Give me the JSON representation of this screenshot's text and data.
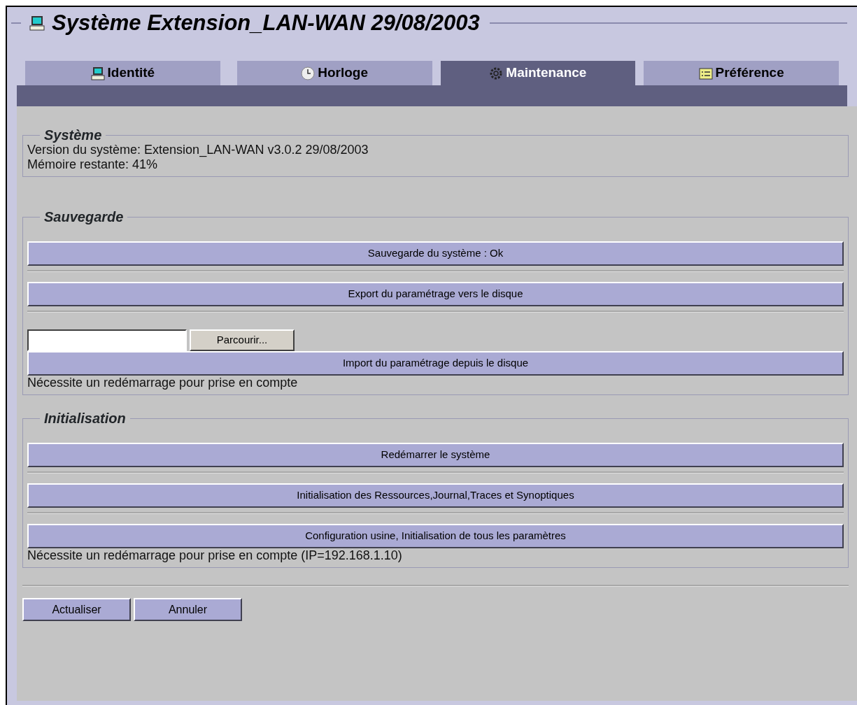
{
  "window": {
    "title": "Système Extension_LAN-WAN 29/08/2003"
  },
  "tabs": [
    {
      "label": "Identité",
      "selected": false
    },
    {
      "label": "Horloge",
      "selected": false
    },
    {
      "label": "Maintenance",
      "selected": true
    },
    {
      "label": "Préférence",
      "selected": false
    }
  ],
  "sections": [
    {
      "title": "Système",
      "items": [
        {
          "kind": "text",
          "text": "Version du système: Extension_LAN-WAN v3.0.2 29/08/2003"
        },
        {
          "kind": "text",
          "text": "Mémoire restante: 41%"
        }
      ]
    },
    {
      "title": "Sauvegarde",
      "items": [
        {
          "kind": "button",
          "label": "Sauvegarde du système : Ok"
        },
        {
          "kind": "button",
          "label": "Export du paramétrage vers le disque"
        },
        {
          "kind": "file",
          "button": "Parcourir..."
        },
        {
          "kind": "button",
          "label": "Import du paramétrage depuis le disque"
        },
        {
          "kind": "text",
          "text": "Nécessite un redémarrage pour prise en compte"
        }
      ]
    },
    {
      "title": "Initialisation",
      "items": [
        {
          "kind": "button",
          "label": "Redémarrer le système"
        },
        {
          "kind": "button",
          "label": "Initialisation des Ressources,Journal,Traces et Synoptiques"
        },
        {
          "kind": "button",
          "label": "Configuration usine, Initialisation de tous les paramètres"
        },
        {
          "kind": "text",
          "text": "Nécessite un redémarrage pour prise en compte (IP=192.168.1.10)"
        }
      ]
    }
  ],
  "footer_buttons": [
    "Actualiser",
    "Annuler"
  ]
}
